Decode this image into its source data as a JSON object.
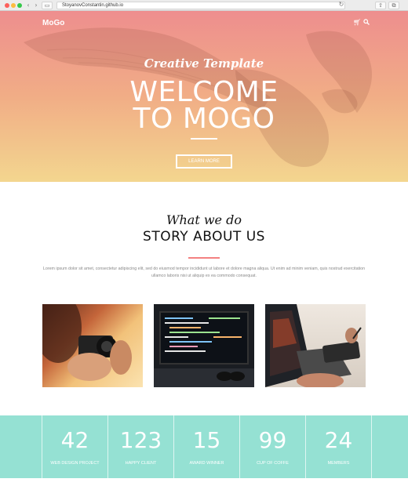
{
  "browser": {
    "url": "StoyanovConstantin.github.io",
    "back_icon": "chevron-left-icon",
    "forward_icon": "chevron-right-icon",
    "sidebar_icon": "sidebar-icon",
    "reload_icon": "reload-icon",
    "share_icon": "share-icon",
    "tabs_icon": "tabs-icon"
  },
  "hero": {
    "logo": "MoGo",
    "cart_icon": "cart-icon",
    "search_icon": "search-icon",
    "tagline": "Creative Template",
    "headline_line1": "WELCOME",
    "headline_line2": "TO MOGO",
    "button_label": "LEARN MORE",
    "background_image": "eagle-illustration",
    "gradient_top": "#ee8e8e",
    "gradient_bottom": "#f3d68f"
  },
  "about": {
    "script_title": "What we do",
    "title": "STORY ABOUT US",
    "body": "Lorem ipsum dolor sit amet, consectetur adipiscing elit, sed do eiusmod tempor incididunt ut labore et dolore magna aliqua. Ut enim ad minim veniam, quis nostrud exercitation ullamco laboris nisi ut aliquip ex ea commodo consequat.",
    "accent_color": "#f38181"
  },
  "photos": [
    {
      "subject": "photographer-with-camera"
    },
    {
      "subject": "code-on-monitor"
    },
    {
      "subject": "laptop-and-drawing-tablet"
    }
  ],
  "stats": {
    "background": "#95e1d3",
    "items": [
      {
        "number": "42",
        "label": "WEB DESIGN PROJECT"
      },
      {
        "number": "123",
        "label": "HAPPY CLIENT"
      },
      {
        "number": "15",
        "label": "AWARD WINNER"
      },
      {
        "number": "99",
        "label": "CUP OF COFFE"
      },
      {
        "number": "24",
        "label": "MEMBERS"
      }
    ]
  }
}
